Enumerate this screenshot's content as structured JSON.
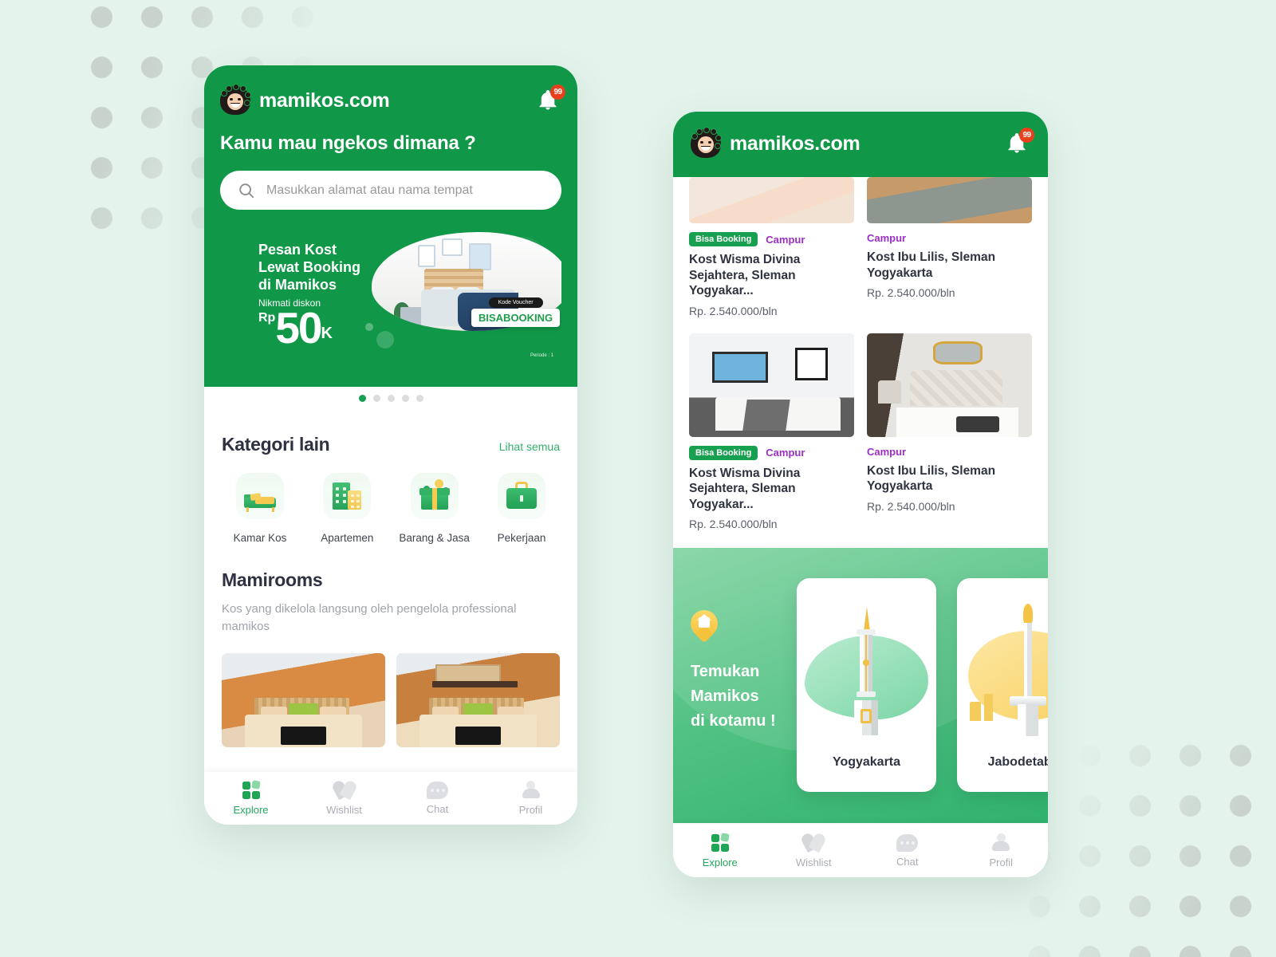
{
  "app": {
    "brand": "mamikos.com",
    "notification_badge": "99",
    "accent_green": "#119748",
    "link_green": "#32b06a",
    "tag_purple": "#9b2fc4",
    "badge_red": "#e8401c"
  },
  "phone_one": {
    "header": {
      "title": "Kamu mau ngekos dimana ?",
      "search_placeholder": "Masukkan alamat atau nama tempat"
    },
    "banner": {
      "line1": "Pesan Kost",
      "line2": "Lewat Booking",
      "line3": "di Mamikos",
      "subtitle": "Nikmati diskon",
      "currency": "Rp",
      "amount": "50",
      "amount_suffix": "K",
      "voucher_label": "Kode Voucher",
      "voucher_code": "BISABOOKING",
      "period_note": "Periode : 1",
      "slides": 5,
      "active_slide": 1
    },
    "categories_section": {
      "title": "Kategori lain",
      "see_all": "Lihat semua",
      "items": [
        {
          "label": "Kamar Kos",
          "icon": "bed-icon"
        },
        {
          "label": "Apartemen",
          "icon": "building-icon"
        },
        {
          "label": "Barang & Jasa",
          "icon": "gift-box-icon"
        },
        {
          "label": "Pekerjaan",
          "icon": "briefcase-icon"
        }
      ]
    },
    "mamirooms_section": {
      "title": "Mamirooms",
      "subtitle": "Kos yang dikelola langsung oleh pengelola professional mamikos"
    }
  },
  "phone_two": {
    "listings": [
      {
        "booking_tag": "Bisa Booking",
        "type_tag": "Campur",
        "title": "Kost Wisma Divina Sejahtera, Sleman Yogyakar...",
        "price": "Rp. 2.540.000/bln"
      },
      {
        "booking_tag": "",
        "type_tag": "Campur",
        "title": "Kost Ibu Lilis, Sleman Yogyakarta",
        "price": "Rp. 2.540.000/bln"
      },
      {
        "booking_tag": "Bisa Booking",
        "type_tag": "Campur",
        "title": "Kost Wisma Divina Sejahtera, Sleman Yogyakar...",
        "price": "Rp. 2.540.000/bln"
      },
      {
        "booking_tag": "",
        "type_tag": "Campur",
        "title": "Kost Ibu Lilis, Sleman Yogyakarta",
        "price": "Rp. 2.540.000/bln"
      }
    ],
    "city_banner": {
      "line1": "Temukan",
      "line2": "Mamikos",
      "line3": "di kotamu !",
      "cities": [
        {
          "name": "Yogyakarta",
          "landmark": "tugu-jogja-icon"
        },
        {
          "name": "Jabodetabek",
          "landmark": "monas-icon"
        }
      ]
    }
  },
  "bottom_nav": {
    "items": [
      {
        "label": "Explore",
        "icon": "grid-icon",
        "active": true
      },
      {
        "label": "Wishlist",
        "icon": "heart-icon",
        "active": false
      },
      {
        "label": "Chat",
        "icon": "chat-bubble-icon",
        "active": false
      },
      {
        "label": "Profil",
        "icon": "person-icon",
        "active": false
      }
    ]
  }
}
